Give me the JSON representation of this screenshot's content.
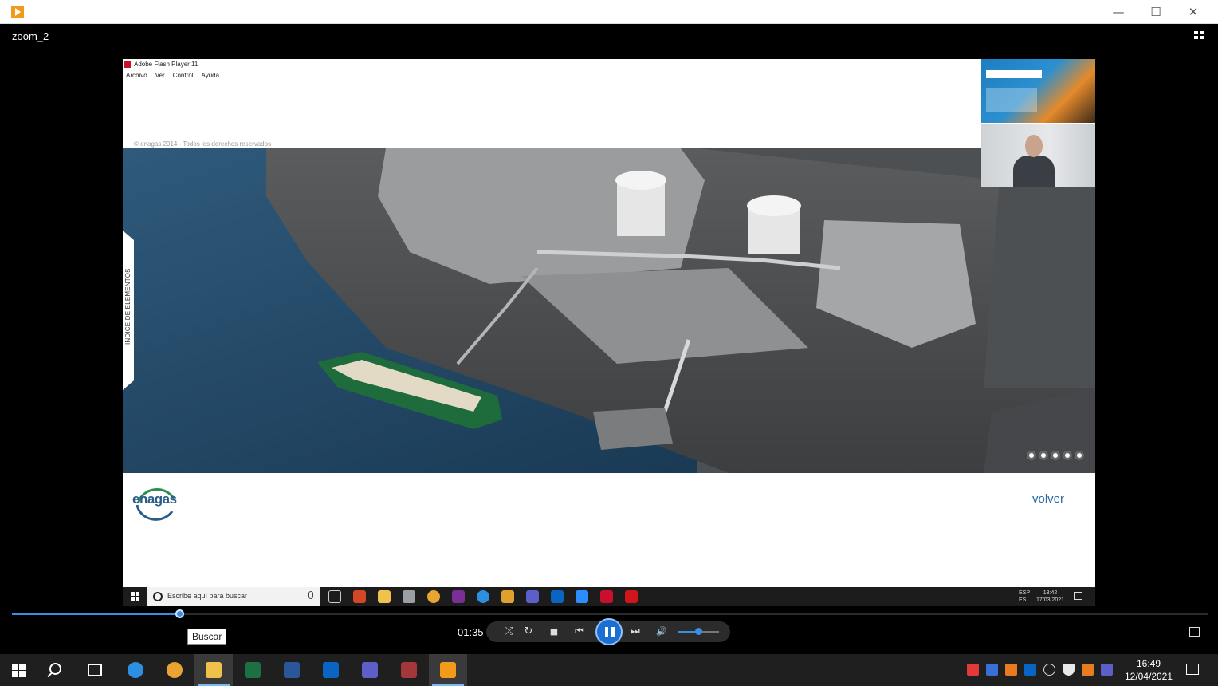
{
  "window": {
    "minimize_glyph": "—",
    "maximize_glyph": "☐",
    "close_glyph": "✕"
  },
  "media": {
    "title": "zoom_2",
    "current_time": "01:35",
    "progress_fraction": 0.14,
    "volume_fraction": 0.5
  },
  "flash": {
    "window_title": "Adobe Flash Player 11",
    "menu": [
      "Archivo",
      "Ver",
      "Control",
      "Ayuda"
    ],
    "copyright": "© enagas 2014 - Todos los derechos reservados",
    "side_tab_label": "INDICE DE ELEMENTOS",
    "logo_text": "enagas",
    "back_link": "volver"
  },
  "inner_taskbar": {
    "search_placeholder": "Escribe aquí para buscar",
    "lang_line1": "ESP",
    "lang_line2": "ES",
    "time": "13:42",
    "date": "17/03/2021"
  },
  "controls": {
    "shuffle": "⤮",
    "repeat": "↻",
    "stop": "■",
    "prev": "⏮",
    "next": "⏭",
    "volume": "🔊"
  },
  "tooltip": "Buscar",
  "taskbar": {
    "time": "16:49",
    "date": "12/04/2021"
  },
  "colors": {
    "accent": "#3b8ee0",
    "play_button": "#1b6fd1",
    "enagas_blue": "#2a5e8a"
  }
}
